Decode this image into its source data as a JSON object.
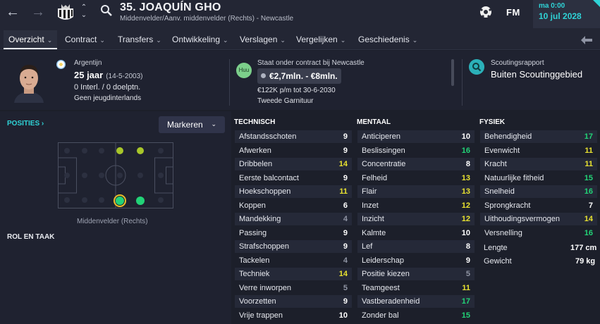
{
  "header": {
    "back_icon": "arrow-left-icon",
    "forward_icon": "arrow-right-icon",
    "player_name": "35. JOAQUÍN GHO",
    "player_sub": "Middenvelder/Aanv. middenvelder (Rechts) - Newcastle",
    "fm_label": "FM",
    "date_line1": "ma 0:00",
    "date_line2": "10 jul 2028"
  },
  "tabs": [
    {
      "label": "Overzicht"
    },
    {
      "label": "Contract"
    },
    {
      "label": "Transfers"
    },
    {
      "label": "Ontwikkeling"
    },
    {
      "label": "Verslagen"
    },
    {
      "label": "Vergelijken"
    },
    {
      "label": "Geschiedenis"
    }
  ],
  "profile": {
    "nationality": "Argentijn",
    "age": "25 jaar",
    "dob": "(14-5-2003)",
    "caps": "0 Interl. / 0 doelptn.",
    "youth": "Geen jeugdinterlands"
  },
  "contract": {
    "badge": "Huu",
    "label": "Staat onder contract bij Newcastle",
    "value": "€2,7mln. - €8mln.",
    "wage": "€122K p/m tot 30-6-2030",
    "squad": "Tweede Garnituur"
  },
  "scouting": {
    "label": "Scoutingsrapport",
    "value": "Buiten Scoutinggebied"
  },
  "positions": {
    "title": "POSITIES ›",
    "dropdown": "Markeren",
    "position_label": "Middenvelder (Rechts)",
    "role_title": "ROL EN TAAK"
  },
  "colors": {
    "good": "#22d377",
    "ok": "#e8e230",
    "average": "#ffffff",
    "poor": "#8f94a3",
    "accent": "#2fd3d6"
  },
  "technical": {
    "title": "TECHNISCH",
    "items": [
      {
        "name": "Afstandsschoten",
        "value": "9"
      },
      {
        "name": "Afwerken",
        "value": "9"
      },
      {
        "name": "Dribbelen",
        "value": "14"
      },
      {
        "name": "Eerste balcontact",
        "value": "9"
      },
      {
        "name": "Hoekschoppen",
        "value": "11"
      },
      {
        "name": "Koppen",
        "value": "6"
      },
      {
        "name": "Mandekking",
        "value": "4"
      },
      {
        "name": "Passing",
        "value": "9"
      },
      {
        "name": "Strafschoppen",
        "value": "9"
      },
      {
        "name": "Tackelen",
        "value": "4"
      },
      {
        "name": "Techniek",
        "value": "14"
      },
      {
        "name": "Verre inworpen",
        "value": "5"
      },
      {
        "name": "Voorzetten",
        "value": "9"
      },
      {
        "name": "Vrije trappen",
        "value": "10"
      }
    ]
  },
  "mental": {
    "title": "MENTAAL",
    "items": [
      {
        "name": "Anticiperen",
        "value": "10"
      },
      {
        "name": "Beslissingen",
        "value": "16"
      },
      {
        "name": "Concentratie",
        "value": "8"
      },
      {
        "name": "Felheid",
        "value": "13"
      },
      {
        "name": "Flair",
        "value": "13"
      },
      {
        "name": "Inzet",
        "value": "12"
      },
      {
        "name": "Inzicht",
        "value": "12"
      },
      {
        "name": "Kalmte",
        "value": "10"
      },
      {
        "name": "Lef",
        "value": "8"
      },
      {
        "name": "Leiderschap",
        "value": "9"
      },
      {
        "name": "Positie kiezen",
        "value": "5"
      },
      {
        "name": "Teamgeest",
        "value": "11"
      },
      {
        "name": "Vastberadenheid",
        "value": "17"
      },
      {
        "name": "Zonder bal",
        "value": "15"
      }
    ]
  },
  "physical": {
    "title": "FYSIEK",
    "items": [
      {
        "name": "Behendigheid",
        "value": "17"
      },
      {
        "name": "Evenwicht",
        "value": "11"
      },
      {
        "name": "Kracht",
        "value": "11"
      },
      {
        "name": "Natuurlijke fitheid",
        "value": "15"
      },
      {
        "name": "Snelheid",
        "value": "16"
      },
      {
        "name": "Sprongkracht",
        "value": "7"
      },
      {
        "name": "Uithoudingsvermogen",
        "value": "14"
      },
      {
        "name": "Versnelling",
        "value": "16"
      }
    ],
    "height_label": "Lengte",
    "height_value": "177 cm",
    "weight_label": "Gewicht",
    "weight_value": "79 kg"
  }
}
